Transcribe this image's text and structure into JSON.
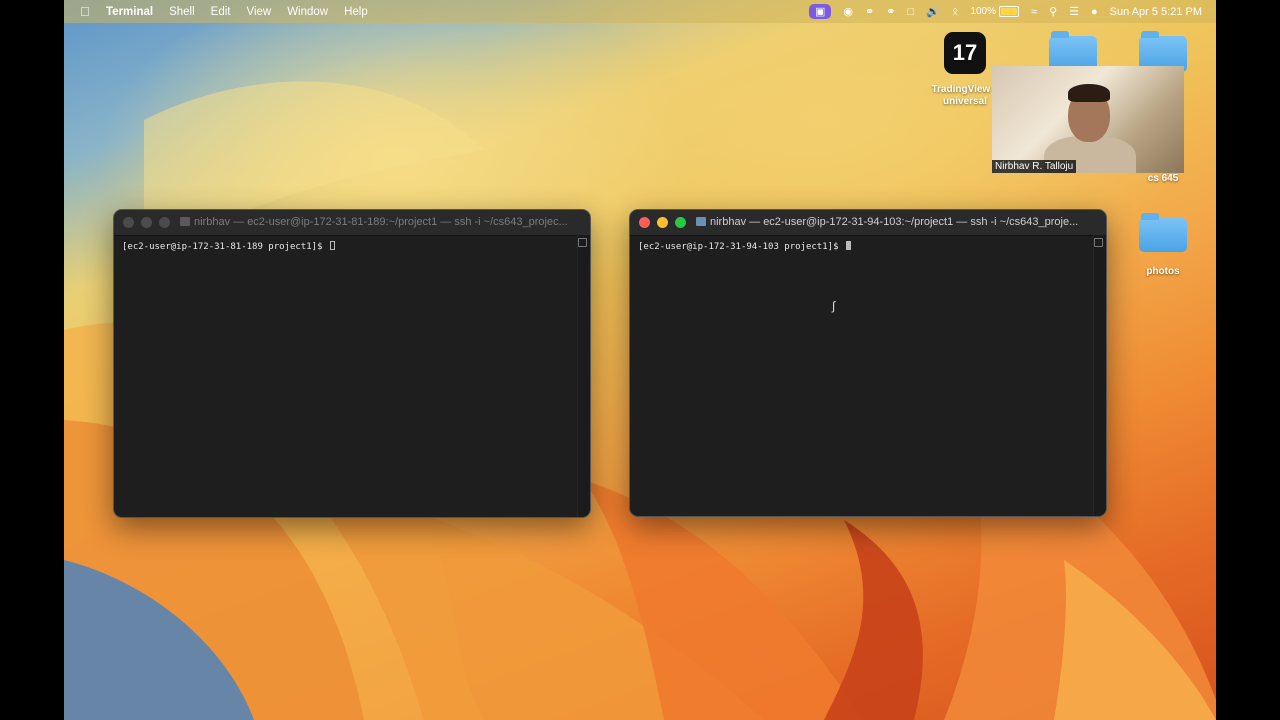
{
  "menubar": {
    "app_name": "Terminal",
    "items": [
      "Shell",
      "Edit",
      "View",
      "Window",
      "Help"
    ],
    "battery": "100%",
    "datetime": "Sun Apr 5  5:21 PM"
  },
  "desktop": {
    "icons": [
      {
        "label": "TradingView 2\nuniversal",
        "type": "app"
      },
      {
        "label": "cs 645",
        "type": "folder"
      },
      {
        "label": "photos",
        "type": "folder"
      }
    ]
  },
  "webcam": {
    "name": "Nirbhav R. Talloju"
  },
  "windows": [
    {
      "title": "nirbhav — ec2-user@ip-172-31-81-189:~/project1 — ssh -i ~/cs643_projec...",
      "prompt": "[ec2-user@ip-172-31-81-189 project1]$ ",
      "active": false
    },
    {
      "title": "nirbhav — ec2-user@ip-172-31-94-103:~/project1 — ssh -i ~/cs643_proje...",
      "prompt": "[ec2-user@ip-172-31-94-103 project1]$ ",
      "active": true
    }
  ]
}
